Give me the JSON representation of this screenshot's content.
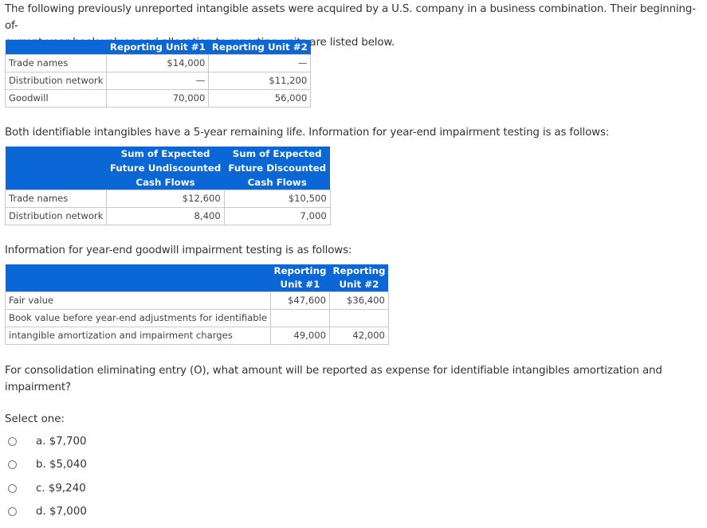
{
  "intro": {
    "line1": "The following previously unreported intangible assets were acquired by a U.S. company in a business combination. Their beginning-of-",
    "line2": "current-year book values and allocation to reporting units are listed below."
  },
  "table1": {
    "headers": [
      "",
      "Reporting Unit #1",
      "Reporting Unit #2"
    ],
    "rows": [
      {
        "label": "Trade names",
        "values": [
          "$14,000",
          "—"
        ]
      },
      {
        "label": "Distribution network",
        "values": [
          "—",
          "$11,200"
        ]
      },
      {
        "label": "Goodwill",
        "values": [
          "70,000",
          "56,000"
        ]
      }
    ]
  },
  "para2": "Both identifiable intangibles have a 5-year remaining life. Information for year-end impairment testing is as follows:",
  "table2": {
    "headers": [
      "",
      [
        "Sum of Expected",
        "Future Undiscounted",
        "Cash Flows"
      ],
      [
        "Sum of Expected",
        "Future Discounted",
        "Cash Flows"
      ]
    ],
    "rows": [
      {
        "label": "Trade names",
        "values": [
          "$12,600",
          "$10,500"
        ]
      },
      {
        "label": "Distribution network",
        "values": [
          "8,400",
          "7,000"
        ]
      }
    ]
  },
  "para3": "Information for year-end goodwill impairment testing is as follows:",
  "table3": {
    "headers": [
      "",
      [
        "Reporting",
        "Unit #1"
      ],
      [
        "Reporting",
        "Unit #2"
      ]
    ],
    "rows": [
      {
        "label": "Fair value",
        "values": [
          "$47,600",
          "$36,400"
        ]
      },
      {
        "label": "Book value before year-end adjustments for identifiable",
        "values": [
          "",
          ""
        ]
      },
      {
        "label": "intangible amortization and impairment charges",
        "values": [
          "49,000",
          "42,000"
        ]
      }
    ]
  },
  "question": {
    "line1": "For consolidation eliminating entry (O), what amount will be reported as expense for identifiable intangibles amortization and",
    "line2": "impairment?"
  },
  "answer": {
    "select_label": "Select one:",
    "options": [
      {
        "label": "a. $7,700",
        "selected": false
      },
      {
        "label": "b. $5,040",
        "selected": false
      },
      {
        "label": "c. $9,240",
        "selected": false
      },
      {
        "label": "d. $7,000",
        "selected": false
      }
    ]
  },
  "colors": {
    "header_bg": "#0b66d6",
    "header_text": "#ffffff",
    "border": "#c9c9c9",
    "text": "#333333"
  }
}
